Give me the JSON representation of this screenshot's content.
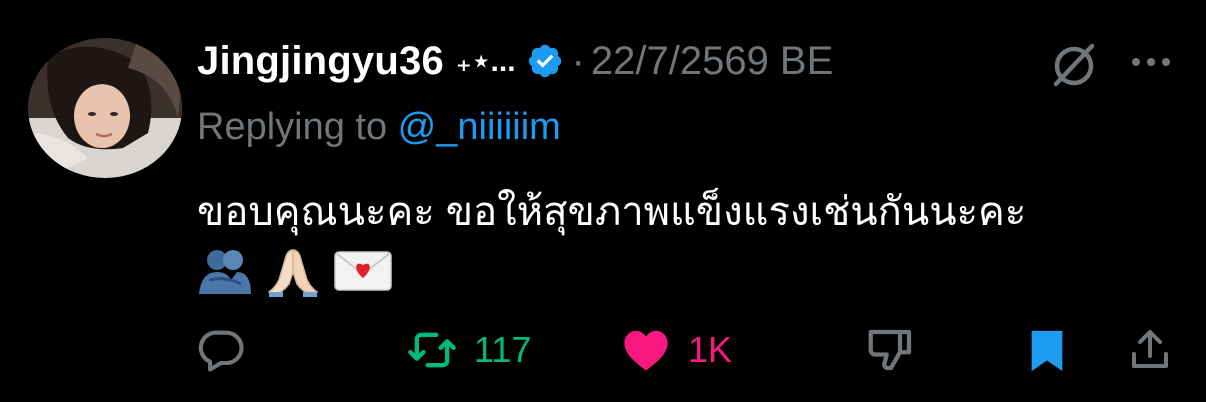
{
  "colors": {
    "background": "#000000",
    "text": "#ffffff",
    "muted": "#71767b",
    "link": "#1d9bf0",
    "retweet": "#00ba7c",
    "like": "#f91880",
    "bookmark": "#1d9bf0"
  },
  "tweet": {
    "display_name": "Jingjingyu36",
    "name_decoration": "₊⋆...",
    "verified": true,
    "separator": "·",
    "timestamp": "22/7/2569 BE",
    "replying_prefix": "Replying to ",
    "replying_handle": "@_niiiiiim",
    "text": "ขอบคุณนะคะ ขอให้สุขภาพแข็งแรงเช่นกันนะคะ",
    "emojis": [
      "people-hugging",
      "folded-hands",
      "love-letter"
    ]
  },
  "actions": {
    "reply": {
      "icon": "reply-icon"
    },
    "retweet": {
      "icon": "retweet-icon",
      "count": "117"
    },
    "like": {
      "icon": "heart-icon",
      "count": "1K",
      "active": true
    },
    "dislike": {
      "icon": "thumbs-down-icon"
    },
    "bookmark": {
      "icon": "bookmark-icon",
      "active": true
    },
    "share": {
      "icon": "share-icon"
    }
  },
  "header_icons": [
    "grok-icon",
    "more-icon"
  ]
}
